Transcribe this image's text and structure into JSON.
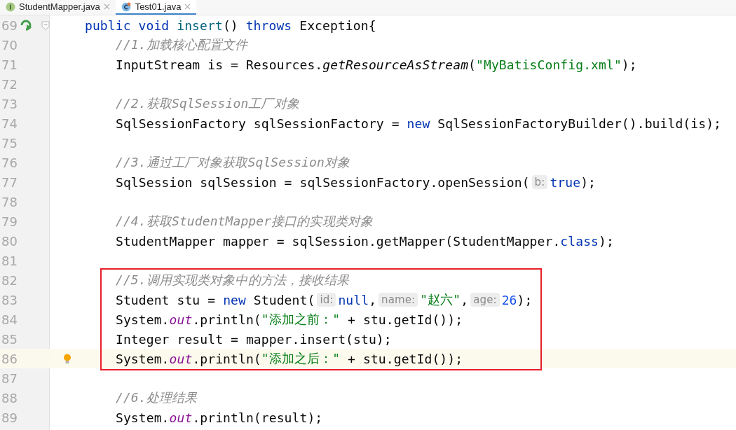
{
  "tabs": [
    {
      "label": "StudentMapper.java",
      "kind": "interface",
      "selected": false
    },
    {
      "label": "Test01.java",
      "kind": "class",
      "selected": true
    }
  ],
  "lines": [
    {
      "number": "69",
      "runnable": true,
      "current": false,
      "boxed": false,
      "tokens": [
        {
          "text": "public void ",
          "kind": "keyword"
        },
        {
          "text": "insert",
          "kind": "declaration"
        },
        {
          "text": "() ",
          "kind": "plain"
        },
        {
          "text": "throws",
          "kind": "keyword"
        },
        {
          "text": " Exception{",
          "kind": "plain"
        }
      ],
      "children": [
        {
          "number": "70",
          "current": false,
          "boxed": false,
          "tokens": [
            {
              "text": "//1.加载核心配置文件",
              "kind": "comment"
            }
          ]
        },
        {
          "number": "71",
          "current": false,
          "boxed": false,
          "tokens": [
            {
              "text": "InputStream is = Resources.",
              "kind": "plain"
            },
            {
              "text": "getResourceAsStream",
              "kind": "static-method"
            },
            {
              "text": "(",
              "kind": "plain"
            },
            {
              "text": "\"MyBatisConfig.xml\"",
              "kind": "string"
            },
            {
              "text": ");",
              "kind": "plain"
            }
          ]
        },
        {
          "number": "72",
          "current": false,
          "boxed": false
        },
        {
          "number": "73",
          "current": false,
          "boxed": false,
          "tokens": [
            {
              "text": "//2.获取SqlSession工厂对象",
              "kind": "comment"
            }
          ]
        },
        {
          "number": "74",
          "current": false,
          "boxed": false,
          "tokens": [
            {
              "text": "SqlSessionFactory sqlSessionFactory = ",
              "kind": "plain"
            },
            {
              "text": "new",
              "kind": "keyword"
            },
            {
              "text": " SqlSessionFactoryBuilder().build(is);",
              "kind": "plain"
            }
          ]
        },
        {
          "number": "75",
          "current": false,
          "boxed": false
        },
        {
          "number": "76",
          "current": false,
          "boxed": false,
          "tokens": [
            {
              "text": "//3.通过工厂对象获取SqlSession对象",
              "kind": "comment"
            }
          ]
        },
        {
          "number": "77",
          "current": false,
          "boxed": false,
          "tokens": [
            {
              "text": "SqlSession sqlSession = sqlSessionFactory.openSession(",
              "kind": "plain"
            },
            {
              "text": "b:",
              "kind": "hint"
            },
            {
              "text": "true",
              "kind": "keyword"
            },
            {
              "text": ");",
              "kind": "plain"
            }
          ]
        },
        {
          "number": "78",
          "current": false,
          "boxed": false
        },
        {
          "number": "79",
          "current": false,
          "boxed": false,
          "tokens": [
            {
              "text": "//4.获取StudentMapper接口的实现类对象",
              "kind": "comment"
            }
          ]
        },
        {
          "number": "80",
          "current": false,
          "boxed": false,
          "tokens": [
            {
              "text": "StudentMapper mapper = sqlSession.getMapper(StudentMapper.",
              "kind": "plain"
            },
            {
              "text": "class",
              "kind": "keyword"
            },
            {
              "text": ");",
              "kind": "plain"
            }
          ]
        },
        {
          "number": "81",
          "current": false,
          "boxed": false
        },
        {
          "number": "82",
          "current": false,
          "boxed": true,
          "tokens": [
            {
              "text": "//5.调用实现类对象中的方法，接收结果",
              "kind": "comment"
            }
          ]
        },
        {
          "number": "83",
          "current": false,
          "boxed": true,
          "tokens": [
            {
              "text": "Student stu = ",
              "kind": "plain"
            },
            {
              "text": "new",
              "kind": "keyword"
            },
            {
              "text": " Student(",
              "kind": "plain"
            },
            {
              "text": "id:",
              "kind": "hint"
            },
            {
              "text": "null",
              "kind": "keyword"
            },
            {
              "text": ",",
              "kind": "plain"
            },
            {
              "text": "name:",
              "kind": "hint"
            },
            {
              "text": "\"赵六\"",
              "kind": "string"
            },
            {
              "text": ",",
              "kind": "plain"
            },
            {
              "text": "age:",
              "kind": "hint"
            },
            {
              "text": "26",
              "kind": "number"
            },
            {
              "text": ");",
              "kind": "plain"
            }
          ]
        },
        {
          "number": "84",
          "current": false,
          "boxed": true,
          "tokens": [
            {
              "text": "System.",
              "kind": "plain"
            },
            {
              "text": "out",
              "kind": "static-field"
            },
            {
              "text": ".println(",
              "kind": "plain"
            },
            {
              "text": "\"添加之前：\"",
              "kind": "string"
            },
            {
              "text": " + stu.getId());",
              "kind": "plain"
            }
          ]
        },
        {
          "number": "85",
          "current": false,
          "boxed": true,
          "tokens": [
            {
              "text": "Integer result = mapper.insert(stu);",
              "kind": "plain"
            }
          ]
        },
        {
          "number": "86",
          "intention_bulb": true,
          "current": true,
          "boxed": true,
          "tokens": [
            {
              "text": "System.",
              "kind": "plain"
            },
            {
              "text": "out",
              "kind": "static-field"
            },
            {
              "text": ".println(",
              "kind": "plain"
            },
            {
              "text": "\"添加之后：\"",
              "kind": "string"
            },
            {
              "text": " + stu.getId());",
              "kind": "plain"
            }
          ]
        },
        {
          "number": "87",
          "current": false,
          "boxed": false
        },
        {
          "number": "88",
          "current": false,
          "boxed": false,
          "tokens": [
            {
              "text": "//6.处理结果",
              "kind": "comment"
            }
          ]
        },
        {
          "number": "89",
          "current": false,
          "boxed": false,
          "tokens": [
            {
              "text": "System.",
              "kind": "plain"
            },
            {
              "text": "out",
              "kind": "static-field"
            },
            {
              "text": ".println(result);",
              "kind": "plain"
            }
          ]
        }
      ]
    }
  ]
}
